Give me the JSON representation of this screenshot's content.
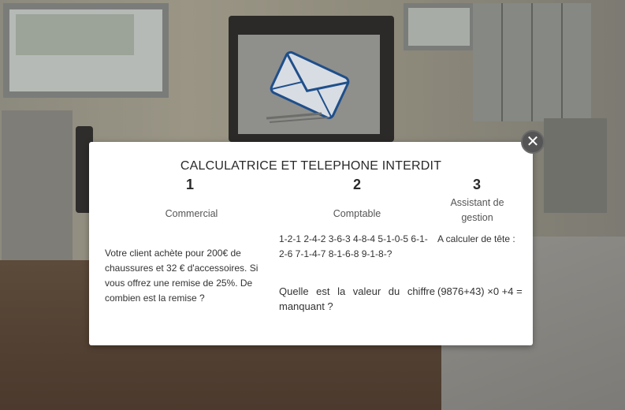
{
  "modal": {
    "title": "CALCULATRICE ET TELEPHONE INTERDIT",
    "close_symbol": "✕",
    "columns": [
      {
        "number": "1",
        "role": "Commercial",
        "text": "Votre client achète pour 200€ de chaussures et 32 € d'accessoires. Si vous offrez une remise de 25%. De combien est la remise ?"
      },
      {
        "number": "2",
        "role": "Comptable",
        "sequence": "1-2-1 2-4-2 3-6-3 4-8-4 5-1-0-5 6-1-2-6 7-1-4-7 8-1-6-8 9-1-8-?",
        "question": "Quelle est la valeur du chiffre manquant ?"
      },
      {
        "number": "3",
        "role": "Assistant de gestion",
        "intro": "A calculer de tête :",
        "formula": "(9876+43) ×0 +4 ="
      }
    ]
  },
  "icons": {
    "close": "close-icon",
    "envelope": "envelope-icon"
  },
  "colors": {
    "modal_bg": "#ffffff",
    "close_bg": "#555555"
  }
}
